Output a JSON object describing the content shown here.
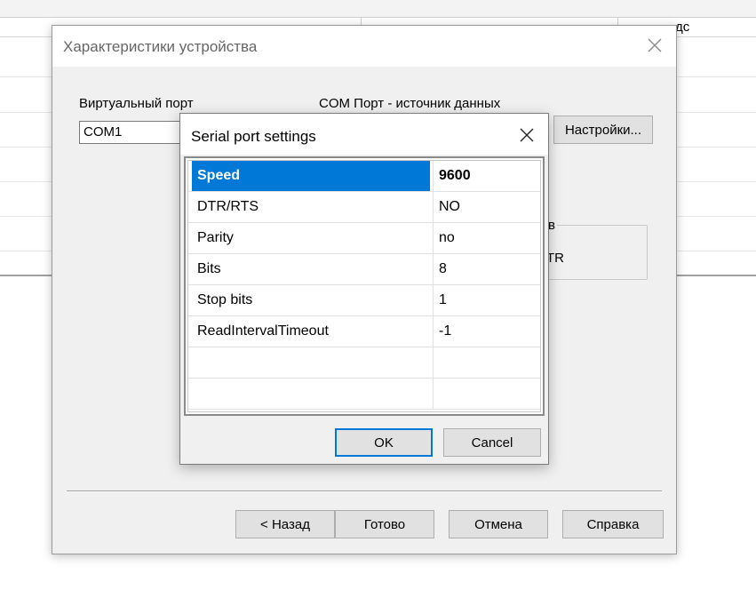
{
  "background": {
    "header_fragment": "дс"
  },
  "wizard": {
    "title": "Характеристики устройства",
    "virtual_port_label": "Виртуальный порт",
    "virtual_port_value": "COM1",
    "com_source_label": "COM Порт - источник данных",
    "settings_button": "Настройки...",
    "group_fragment": "в",
    "group_text_fragment": "TR",
    "buttons": {
      "back": "< Назад",
      "finish": "Готово",
      "cancel": "Отмена",
      "help": "Справка"
    }
  },
  "serial_dialog": {
    "title": "Serial port settings",
    "rows": [
      {
        "name": "Speed",
        "value": "9600"
      },
      {
        "name": "DTR/RTS",
        "value": "NO"
      },
      {
        "name": "Parity",
        "value": "no"
      },
      {
        "name": "Bits",
        "value": "8"
      },
      {
        "name": "Stop bits",
        "value": "1"
      },
      {
        "name": "ReadIntervalTimeout",
        "value": "-1"
      },
      {
        "name": "",
        "value": ""
      },
      {
        "name": "",
        "value": ""
      }
    ],
    "selected_row_index": 0,
    "ok_label": "OK",
    "cancel_label": "Cancel"
  },
  "colors": {
    "selection": "#0078d7",
    "dialog_bg": "#f0f0f0"
  }
}
